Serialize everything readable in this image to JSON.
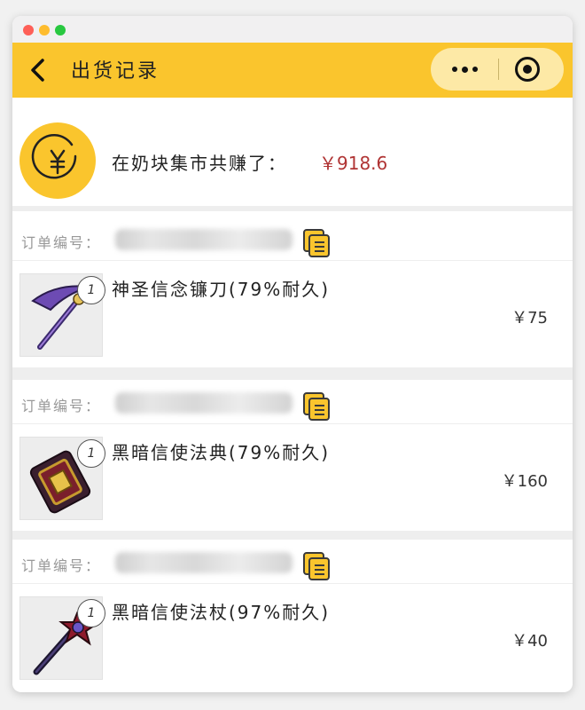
{
  "window": {
    "controls": [
      "close",
      "minimize",
      "maximize"
    ]
  },
  "header": {
    "back_icon": "chevron-left-icon",
    "title": "出货记录",
    "more_icon": "more-dots-icon",
    "close_icon": "target-icon"
  },
  "summary": {
    "coin_icon": "yuan-coin-icon",
    "label": "在奶块集市共赚了：",
    "amount": "￥918.6"
  },
  "orders": [
    {
      "order_label": "订单编号：",
      "order_number": "",
      "copy_icon": "copy-icon",
      "quantity": "1",
      "item_icon": "scythe-icon",
      "item_name": "神圣信念镰刀(79%耐久)",
      "price": "￥75"
    },
    {
      "order_label": "订单编号：",
      "order_number": "",
      "copy_icon": "copy-icon",
      "quantity": "1",
      "item_icon": "spellbook-icon",
      "item_name": "黑暗信使法典(79%耐久)",
      "price": "￥160"
    },
    {
      "order_label": "订单编号：",
      "order_number": "",
      "copy_icon": "copy-icon",
      "quantity": "1",
      "item_icon": "staff-icon",
      "item_name": "黑暗信使法杖(97%耐久)",
      "price": "￥40"
    }
  ],
  "colors": {
    "accent": "#fac52d",
    "amount": "#b03434",
    "label_gray": "#999999"
  }
}
